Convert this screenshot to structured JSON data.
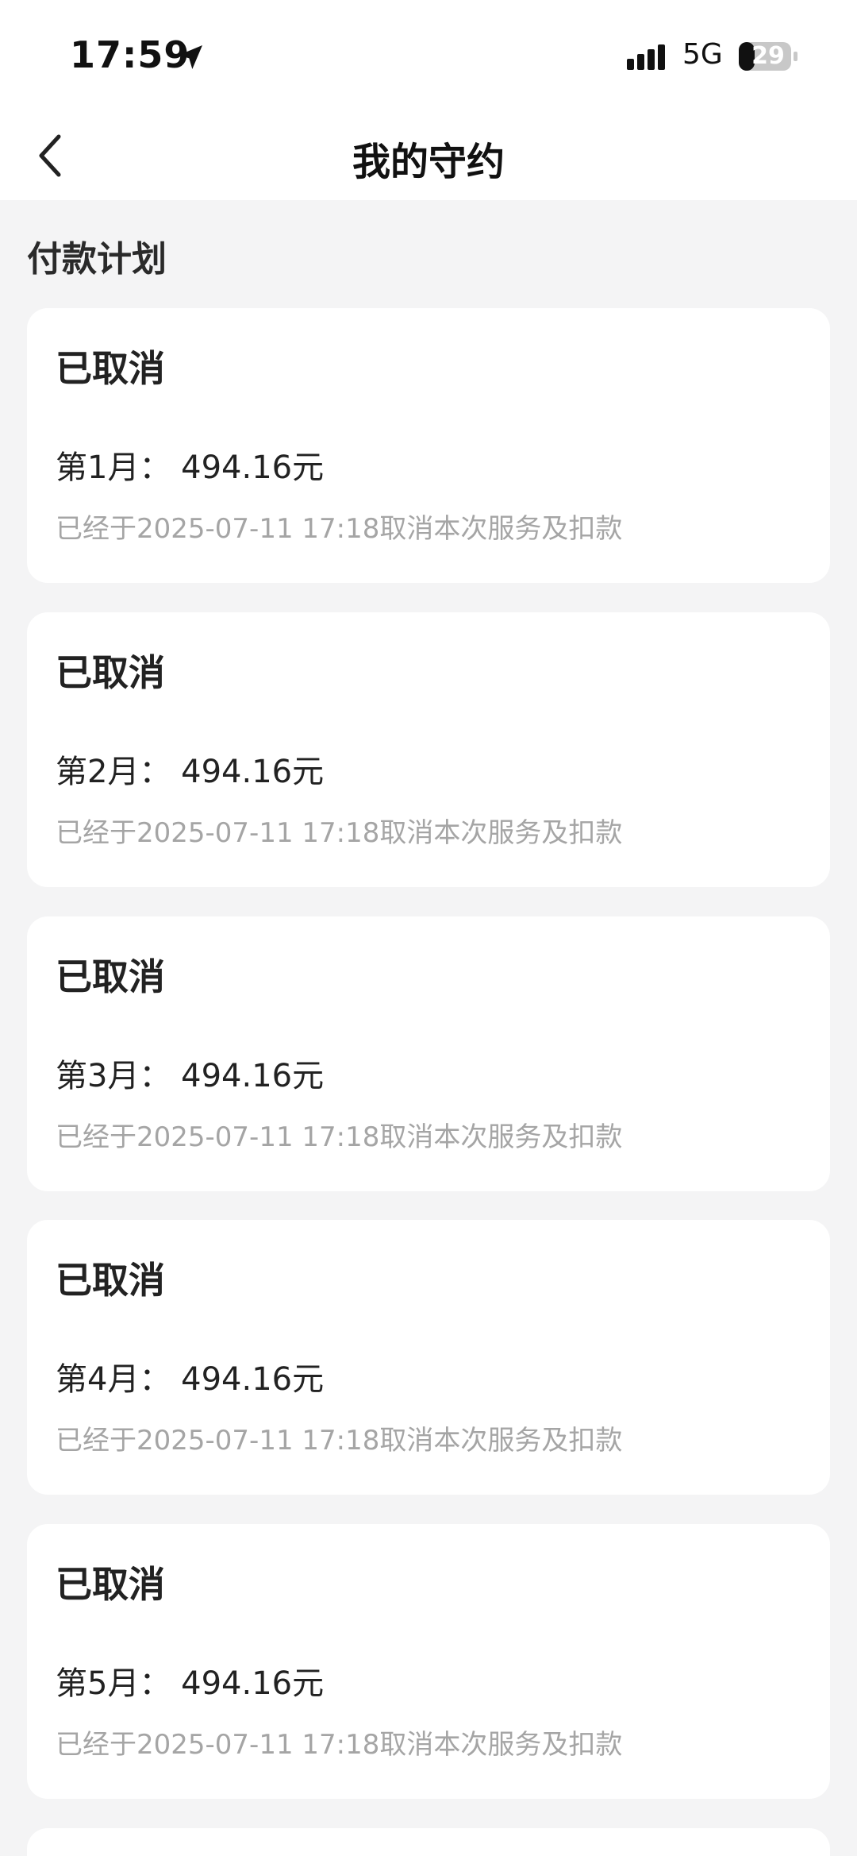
{
  "status_bar": {
    "time": "17:59",
    "network": "5G",
    "battery": "29",
    "icons": [
      "location-arrow-icon",
      "signal-icon",
      "battery-icon"
    ]
  },
  "nav": {
    "title": "我的守约",
    "back_icon": "chevron-left-icon"
  },
  "section": {
    "title": "付款计划"
  },
  "plans": [
    {
      "status": "已取消",
      "amount": "第1月：  494.16元",
      "note": "已经于2025-07-11 17:18取消本次服务及扣款"
    },
    {
      "status": "已取消",
      "amount": "第2月：  494.16元",
      "note": "已经于2025-07-11 17:18取消本次服务及扣款"
    },
    {
      "status": "已取消",
      "amount": "第3月：  494.16元",
      "note": "已经于2025-07-11 17:18取消本次服务及扣款"
    },
    {
      "status": "已取消",
      "amount": "第4月：  494.16元",
      "note": "已经于2025-07-11 17:18取消本次服务及扣款"
    },
    {
      "status": "已取消",
      "amount": "第5月：  494.16元",
      "note": "已经于2025-07-11 17:18取消本次服务及扣款"
    }
  ],
  "colors": {
    "background": "#f4f4f5",
    "card": "#ffffff",
    "muted_text": "#a5a5a5"
  }
}
